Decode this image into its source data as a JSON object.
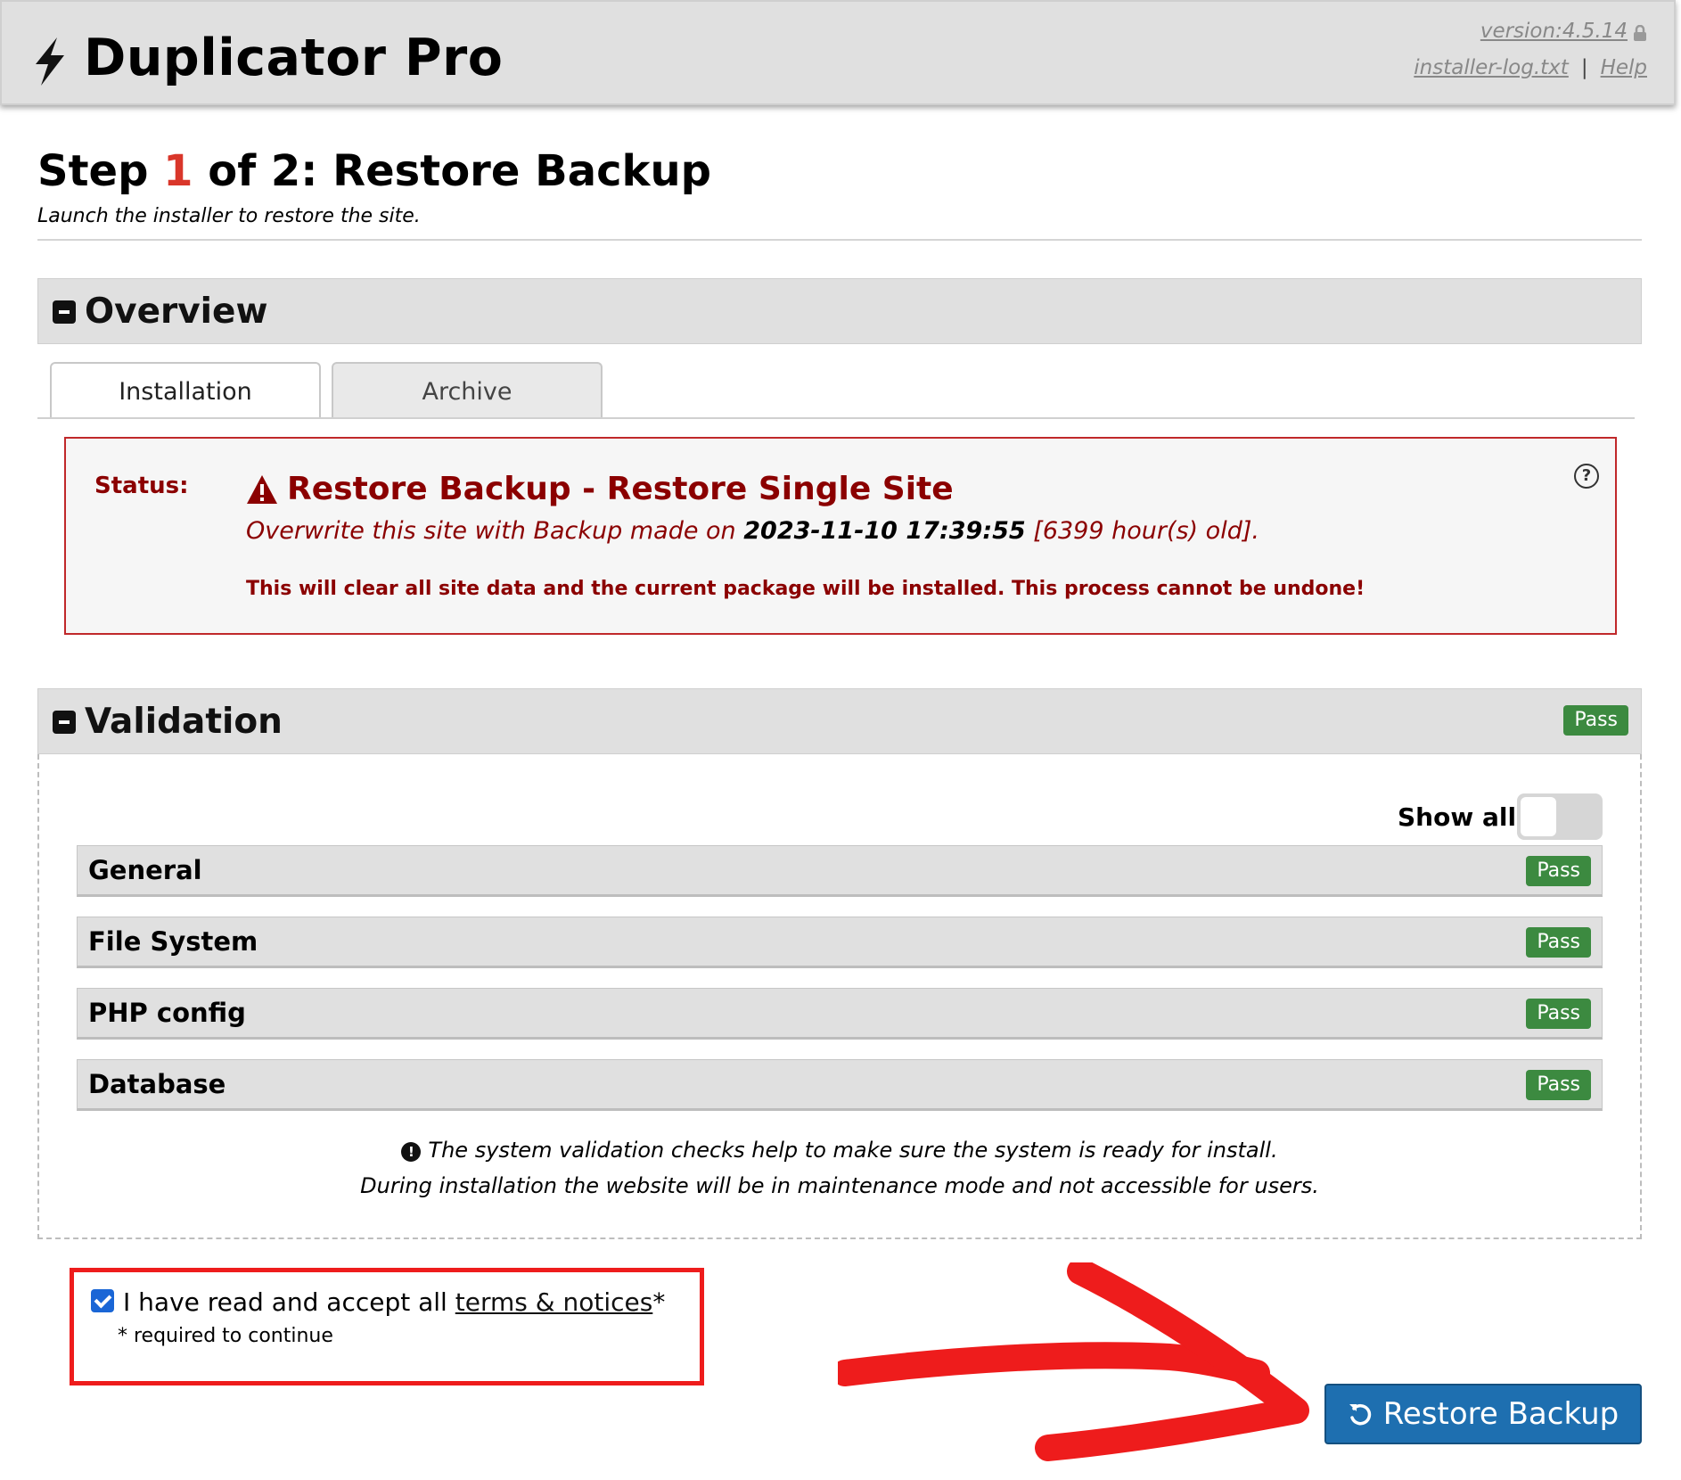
{
  "header": {
    "app_title": "Duplicator Pro",
    "version": "version:4.5.14",
    "log_link": "installer-log.txt",
    "separator": "|",
    "help_link": "Help"
  },
  "step": {
    "prefix": "Step",
    "number": "1",
    "suffix": "of 2: Restore Backup",
    "subtitle": "Launch the installer to restore the site."
  },
  "overview": {
    "title": "Overview",
    "tabs": [
      {
        "label": "Installation",
        "active": true
      },
      {
        "label": "Archive",
        "active": false
      }
    ],
    "status": {
      "label": "Status:",
      "headline": "Restore Backup - Restore Single Site",
      "line_prefix": "Overwrite this site with Backup made on",
      "date": "2023-11-10 17:39:55",
      "age": "[6399 hour(s) old].",
      "warning": "This will clear all site data and the current package will be installed. This process cannot be undone!",
      "help_glyph": "?"
    }
  },
  "validation": {
    "title": "Validation",
    "badge": "Pass",
    "show_all_label": "Show all",
    "show_all_on": false,
    "checks": [
      {
        "label": "General",
        "badge": "Pass"
      },
      {
        "label": "File System",
        "badge": "Pass"
      },
      {
        "label": "PHP config",
        "badge": "Pass"
      },
      {
        "label": "Database",
        "badge": "Pass"
      }
    ],
    "note_line1": "The system validation checks help to make sure the system is ready for install.",
    "note_line2": "During installation the website will be in maintenance mode and not accessible for users.",
    "note_glyph": "!"
  },
  "terms": {
    "checked": true,
    "text_prefix": "I have read and accept all",
    "link": "terms & notices",
    "asterisk": "*",
    "required": "* required to continue"
  },
  "action": {
    "restore_label": "Restore Backup"
  },
  "colors": {
    "accent_red": "#d9362a",
    "status_dark_red": "#8b0000",
    "pass_green": "#3c8a40",
    "button_blue": "#1e6fb0",
    "annotation_red": "#ee1c1c"
  },
  "icons": {
    "logo": "bolt-icon",
    "lock": "lock-icon",
    "warning": "warning-triangle-icon",
    "help": "question-circle-icon",
    "info": "exclamation-circle-icon",
    "restore": "undo-arrow-icon",
    "annotation": "red-arrow-annotation"
  }
}
